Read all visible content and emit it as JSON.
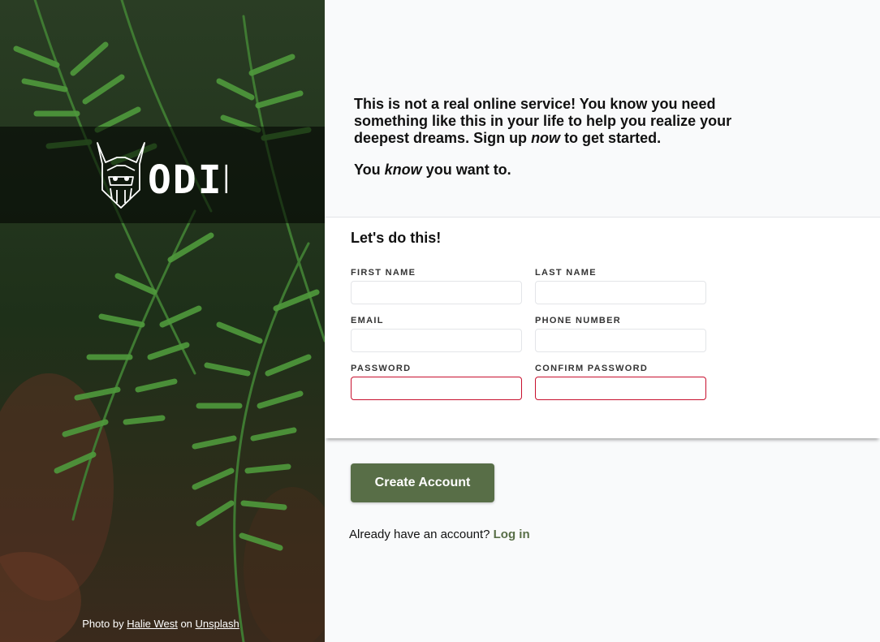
{
  "brand": {
    "logo_text": "ODIN"
  },
  "intro": {
    "p1_a": "This is not a real online service! You know you need something like this in your life to help you realize your deepest dreams. Sign up ",
    "p1_em": "now",
    "p1_b": " to get started.",
    "p2_a": "You ",
    "p2_em": "know",
    "p2_b": " you want to."
  },
  "form": {
    "heading": "Let's do this!",
    "fields": [
      {
        "label": "FIRST NAME",
        "value": ""
      },
      {
        "label": "LAST NAME",
        "value": ""
      },
      {
        "label": "EMAIL",
        "value": ""
      },
      {
        "label": "PHONE NUMBER",
        "value": ""
      },
      {
        "label": "PASSWORD",
        "value": ""
      },
      {
        "label": "CONFIRM PASSWORD",
        "value": ""
      }
    ],
    "submit_label": "Create Account"
  },
  "login": {
    "prompt": "Already have an account?",
    "link": "Log in"
  },
  "credit": {
    "prefix": "Photo by",
    "author": "Halie West",
    "middle": "on",
    "site": "Unsplash"
  },
  "colors": {
    "accent": "#586e47",
    "error_border": "#c8102e",
    "page_bg": "#f9fafb"
  }
}
